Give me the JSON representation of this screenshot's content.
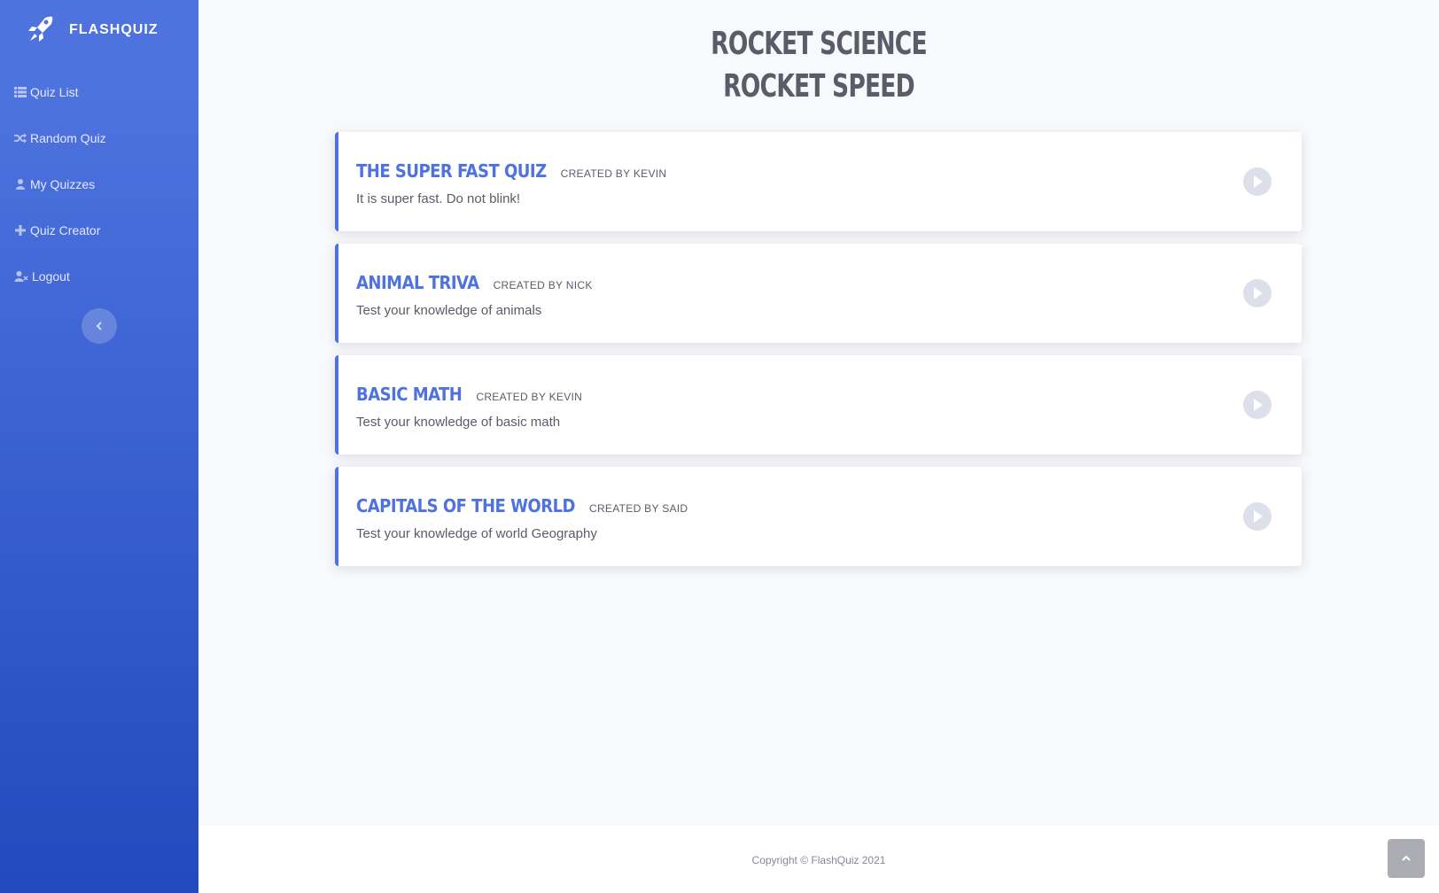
{
  "brand": {
    "name": "FLASHQUIZ",
    "icon": "rocket-icon"
  },
  "sidebar": {
    "items": [
      {
        "label": "Quiz List",
        "icon": "list-icon"
      },
      {
        "label": "Random Quiz",
        "icon": "shuffle-icon"
      },
      {
        "label": "My Quizzes",
        "icon": "user-icon"
      },
      {
        "label": "Quiz Creator",
        "icon": "plus-icon"
      },
      {
        "label": "Logout",
        "icon": "user-times-icon"
      }
    ],
    "toggle_icon": "chevron-left-icon"
  },
  "hero": {
    "line1": "ROCKET SCIENCE",
    "line2": "ROCKET SPEED"
  },
  "quizzes": [
    {
      "title": "THE SUPER FAST QUIZ",
      "author": "CREATED BY KEVIN",
      "description": "It is super fast. Do not blink!"
    },
    {
      "title": "ANIMAL TRIVA",
      "author": "CREATED BY NICK",
      "description": "Test your knowledge of animals"
    },
    {
      "title": "BASIC MATH",
      "author": "CREATED BY KEVIN",
      "description": "Test your knowledge of basic math"
    },
    {
      "title": "CAPITALS OF THE WORLD",
      "author": "CREATED BY SAID",
      "description": "Test your knowledge of world Geography"
    }
  ],
  "footer": {
    "copyright": "Copyright © FlashQuiz 2021"
  },
  "colors": {
    "primary": "#4e73df",
    "primary_dark": "#224abe",
    "text": "#5a5c69",
    "muted": "#858796"
  }
}
